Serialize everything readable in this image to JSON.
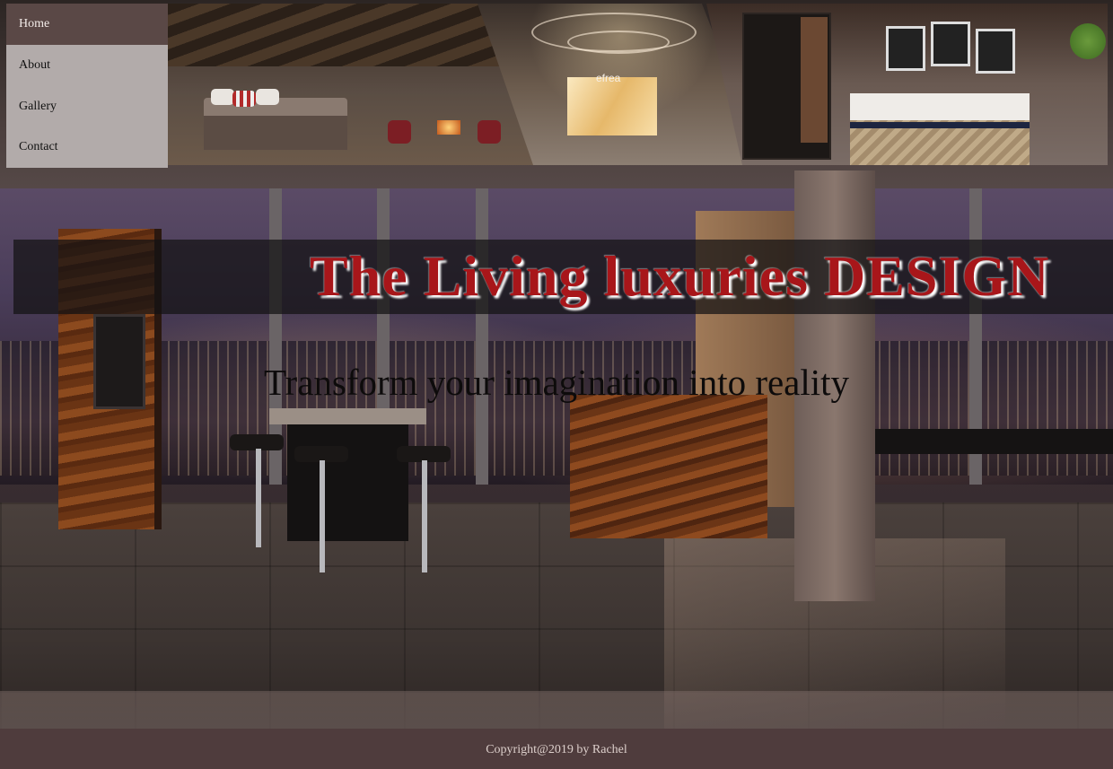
{
  "nav": {
    "items": [
      {
        "label": "Home",
        "active": true
      },
      {
        "label": "About",
        "active": false
      },
      {
        "label": "Gallery",
        "active": false
      },
      {
        "label": "Contact",
        "active": false
      }
    ]
  },
  "hero": {
    "reception_sign": "efrea",
    "photos": [
      "bedroom-photo",
      "reception-lobby-photo",
      "hotel-room-photo"
    ]
  },
  "banner": {
    "title": "The Living luxuries DESIGN"
  },
  "tagline": "Transform your imagination into reality",
  "footer": {
    "copyright": "Copyright@2019 by Rachel"
  },
  "colors": {
    "nav_active_bg": "#5a4846",
    "nav_inactive_bg": "#b2abaa",
    "banner_title": "#a8161a",
    "footer_bg": "#4f3c3d"
  }
}
